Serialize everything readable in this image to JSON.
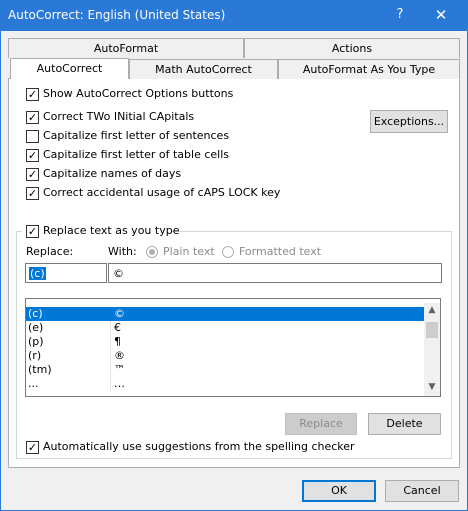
{
  "window": {
    "title": "AutoCorrect: English (United States)",
    "help_label": "?",
    "close_label": "✕"
  },
  "tabs": {
    "row1": [
      {
        "label": "AutoFormat"
      },
      {
        "label": "Actions"
      }
    ],
    "row2": [
      {
        "label": "AutoCorrect",
        "selected": true
      },
      {
        "label": "Math AutoCorrect"
      },
      {
        "label": "AutoFormat As You Type"
      }
    ]
  },
  "options": {
    "show_buttons": {
      "label": "Show AutoCorrect Options buttons",
      "checked": true
    },
    "two_initial": {
      "label": "Correct TWo INitial CApitals",
      "checked": true
    },
    "first_sentence": {
      "label": "Capitalize first letter of sentences",
      "checked": false
    },
    "table_cells": {
      "label": "Capitalize first letter of table cells",
      "checked": true
    },
    "names_days": {
      "label": "Capitalize names of days",
      "checked": true
    },
    "caps_lock": {
      "label": "Correct accidental usage of cAPS LOCK key",
      "checked": true
    }
  },
  "exceptions_button": "Exceptions...",
  "replace_group": {
    "replace_as_type": {
      "label": "Replace text as you type",
      "checked": true
    },
    "replace_label": "Replace:",
    "with_label": "With:",
    "plain_text": "Plain text",
    "formatted_text": "Formatted text",
    "replace_value": "(c)",
    "with_value": "©"
  },
  "entries": [
    {
      "replace": "(c)",
      "with": "©",
      "selected": true
    },
    {
      "replace": "(e)",
      "with": "€"
    },
    {
      "replace": "(p)",
      "with": "¶"
    },
    {
      "replace": "(r)",
      "with": "®"
    },
    {
      "replace": "(tm)",
      "with": "™"
    },
    {
      "replace": "...",
      "with": "…"
    }
  ],
  "replace_button": "Replace",
  "delete_button": "Delete",
  "suggestions": {
    "label": "Automatically use suggestions from the spelling checker",
    "checked": true
  },
  "ok_button": "OK",
  "cancel_button": "Cancel",
  "colors": {
    "titlebar": "#2b79d7",
    "selection": "#0078d7"
  }
}
